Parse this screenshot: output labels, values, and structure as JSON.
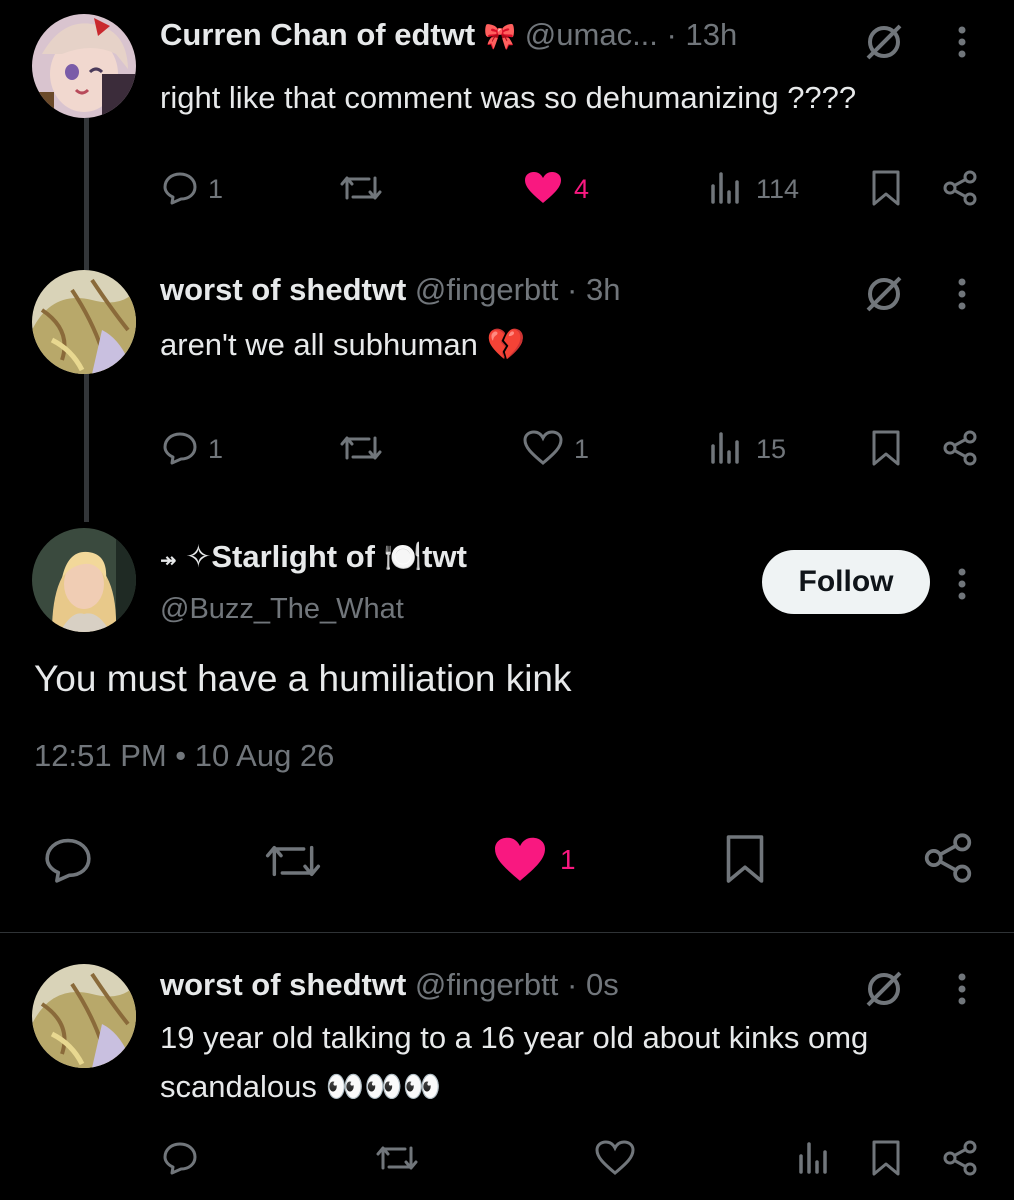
{
  "posts": [
    {
      "name": "Curren Chan of edtwt",
      "name_emoji": "🎀",
      "handle": "@umac...",
      "time": "· 13h",
      "text": "right like that comment was so dehumanizing ????",
      "replies": "1",
      "likes": "4",
      "liked": true,
      "views": "114"
    },
    {
      "name": "worst of shedtwt",
      "handle": "@fingerbtt",
      "time": "· 3h",
      "text": "aren't we all subhuman 💔",
      "replies": "1",
      "likes": "1",
      "liked": false,
      "views": "15"
    }
  ],
  "focused": {
    "prefix": "↠",
    "name": "✧Starlight of 🍽️twt",
    "handle": "@Buzz_The_What",
    "follow_label": "Follow",
    "text": "You must have a humiliation kink",
    "timestamp": "12:51 PM • 10 Aug 26",
    "likes": "1"
  },
  "reply": {
    "name": "worst of shedtwt",
    "handle": "@fingerbtt",
    "time": "· 0s",
    "text_line1": "19 year old talking to a 16 year old about kinks omg",
    "text_line2": "scandalous 👀👀👀"
  },
  "colors": {
    "background": "#000000",
    "text": "#e7e9ea",
    "muted": "#71767b",
    "like": "#f91880",
    "follow_bg": "#eff3f4"
  },
  "icons": [
    "reply-icon",
    "repost-icon",
    "heart-icon",
    "views-icon",
    "bookmark-icon",
    "share-icon",
    "grok-icon",
    "more-icon"
  ]
}
